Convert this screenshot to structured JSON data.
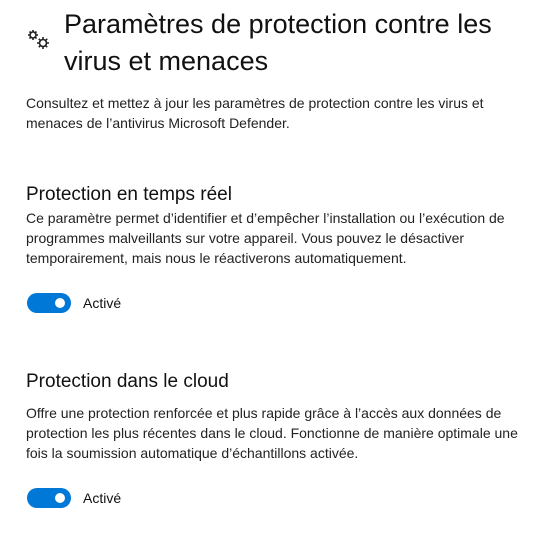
{
  "header": {
    "title": "Paramètres de protection contre les virus et menaces",
    "icon": "gears-icon"
  },
  "intro": "Consultez et mettez à jour les paramètres de protection contre les virus et menaces de l’antivirus Microsoft Defender.",
  "sections": [
    {
      "title": "Protection en temps réel",
      "description": "Ce paramètre permet d’identifier et d’empêcher l’installation ou l’exécution de programmes malveillants sur votre appareil. Vous pouvez le désactiver temporairement, mais nous le réactiverons automatiquement.",
      "toggle_label": "Activé",
      "on": true
    },
    {
      "title": "Protection dans le cloud",
      "description": "Offre une protection renforcée et plus rapide grâce à l’accès aux données de protection les plus récentes dans le cloud. Fonctionne de manière optimale une fois la soumission automatique d’échantillons activée.",
      "toggle_label": "Activé",
      "on": true
    }
  ],
  "accent": "#0078d7"
}
